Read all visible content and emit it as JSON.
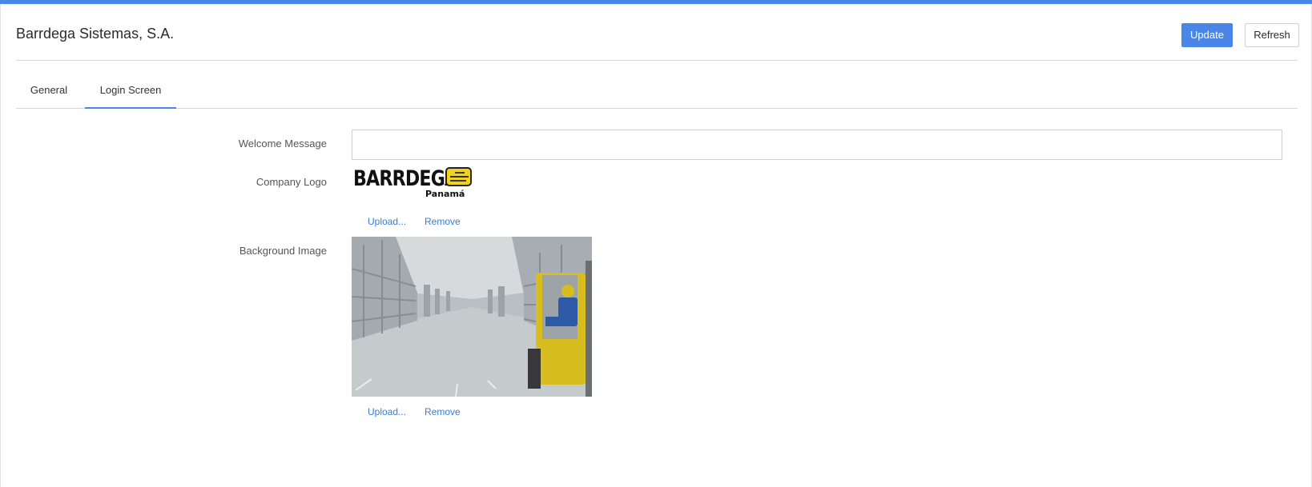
{
  "header": {
    "title": "Barrdega Sistemas, S.A.",
    "update_label": "Update",
    "refresh_label": "Refresh"
  },
  "tabs": [
    {
      "label": "General"
    },
    {
      "label": "Login Screen",
      "active": true
    }
  ],
  "form": {
    "welcome_label": "Welcome Message",
    "welcome_value": "",
    "logo_label": "Company Logo",
    "logo_text": "BARRDEGA",
    "logo_sub": "Panamá",
    "logo_upload": "Upload...",
    "logo_remove": "Remove",
    "background_label": "Background Image",
    "background_upload": "Upload...",
    "background_remove": "Remove"
  },
  "colors": {
    "accent": "#4a86e8",
    "link": "#3a7bd5",
    "badge": "#f1d31b",
    "forklift": "#e3c21d"
  }
}
